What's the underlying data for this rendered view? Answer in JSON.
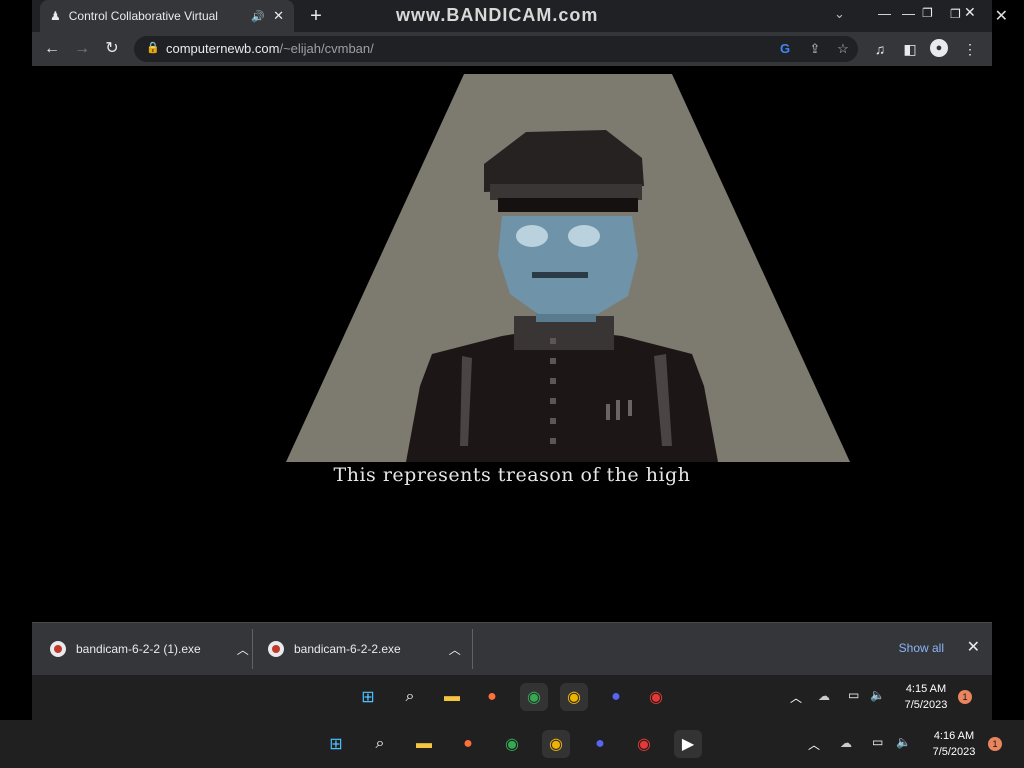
{
  "watermark": "www.BANDICAM.com",
  "tab": {
    "title": "Control Collaborative Virtual"
  },
  "address_bar": {
    "domain": "computernewb.com",
    "path": "/~elijah/cvmban/"
  },
  "game": {
    "subtitle": "This represents treason of the high"
  },
  "downloads": {
    "items": [
      {
        "filename": "bandicam-6-2-2 (1).exe"
      },
      {
        "filename": "bandicam-6-2-2.exe"
      }
    ],
    "show_all_label": "Show all"
  },
  "inner_taskbar": {
    "time": "4:15 AM",
    "date": "7/5/2023",
    "notifications": "1"
  },
  "outer_taskbar": {
    "time": "4:16 AM",
    "date": "7/5/2023",
    "notifications": "1"
  },
  "colors": {
    "accent": "#8ab4f8",
    "spotlight": "#7d7a70"
  }
}
